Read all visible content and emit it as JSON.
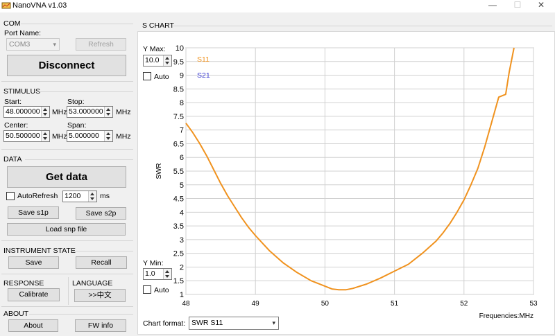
{
  "window": {
    "title": "NanoVNA v1.03",
    "min_glyph": "—",
    "max_glyph": "☐",
    "close_glyph": "✕"
  },
  "com": {
    "title": "COM",
    "port_label": "Port Name:",
    "port_value": "COM3",
    "refresh_label": "Refresh",
    "disconnect_label": "Disconnect"
  },
  "stimulus": {
    "title": "STIMULUS",
    "start_label": "Start:",
    "start_value": "48.000000",
    "stop_label": "Stop:",
    "stop_value": "53.000000",
    "center_label": "Center:",
    "center_value": "50.500000",
    "span_label": "Span:",
    "span_value": "5.000000",
    "unit": "MHz"
  },
  "data_group": {
    "title": "DATA",
    "get_data_label": "Get data",
    "autorefresh_label": "AutoRefresh",
    "autorefresh_checked": false,
    "interval_value": "1200",
    "interval_unit": "ms",
    "save_s1p_label": "Save s1p",
    "save_s2p_label": "Save s2p",
    "load_snp_label": "Load snp file"
  },
  "instrument_state": {
    "title": "INSTRUMENT STATE",
    "save_label": "Save",
    "recall_label": "Recall"
  },
  "response": {
    "title": "RESPONSE",
    "calibrate_label": "Calibrate"
  },
  "language": {
    "title": "LANGUAGE",
    "switch_label": ">>中文"
  },
  "about": {
    "title": "ABOUT",
    "about_label": "About",
    "fw_info_label": "FW info"
  },
  "chart_panel": {
    "title": "S CHART",
    "ymax_label": "Y Max:",
    "ymax_value": "10.0",
    "ymin_label": "Y Min:",
    "ymin_value": "1.0",
    "auto_top_label": "Auto",
    "auto_bottom_label": "Auto",
    "auto_top_checked": false,
    "auto_bottom_checked": false,
    "chart_format_label": "Chart format:",
    "chart_format_value": "SWR S11"
  },
  "chart_data": {
    "type": "line",
    "ylabel": "SWR",
    "xlabel": "Frequencies:MHz",
    "xlim": [
      48,
      53
    ],
    "ylim": [
      1,
      10
    ],
    "x_ticks": [
      "48",
      "49",
      "50",
      "51",
      "52",
      "53"
    ],
    "y_ticks": [
      "1",
      "1.5",
      "2",
      "2.5",
      "3",
      "3.5",
      "4",
      "4.5",
      "5",
      "5.5",
      "6",
      "6.5",
      "7",
      "7.5",
      "8",
      "8.5",
      "9",
      "9.5",
      "10"
    ],
    "grid": true,
    "legend": [
      "S11",
      "S21"
    ],
    "colors": {
      "S11": "#f0921e",
      "S21": "#3a3ad0"
    },
    "series": [
      {
        "name": "S11",
        "x": [
          48.0,
          48.1,
          48.2,
          48.3,
          48.4,
          48.5,
          48.6,
          48.7,
          48.8,
          48.9,
          49.0,
          49.2,
          49.4,
          49.6,
          49.8,
          50.0,
          50.1,
          50.2,
          50.3,
          50.4,
          50.6,
          50.8,
          51.0,
          51.2,
          51.4,
          51.6,
          51.7,
          51.8,
          51.9,
          52.0,
          52.1,
          52.2,
          52.3,
          52.4,
          52.45,
          52.5,
          52.55,
          52.6,
          52.65,
          52.72
        ],
        "y": [
          7.25,
          6.9,
          6.5,
          6.05,
          5.55,
          5.05,
          4.6,
          4.2,
          3.8,
          3.45,
          3.15,
          2.6,
          2.15,
          1.8,
          1.5,
          1.3,
          1.2,
          1.17,
          1.17,
          1.22,
          1.38,
          1.6,
          1.85,
          2.1,
          2.5,
          2.95,
          3.25,
          3.6,
          4.0,
          4.45,
          5.0,
          5.6,
          6.4,
          7.3,
          7.75,
          8.2,
          8.25,
          8.3,
          9.1,
          10.0
        ]
      }
    ]
  }
}
